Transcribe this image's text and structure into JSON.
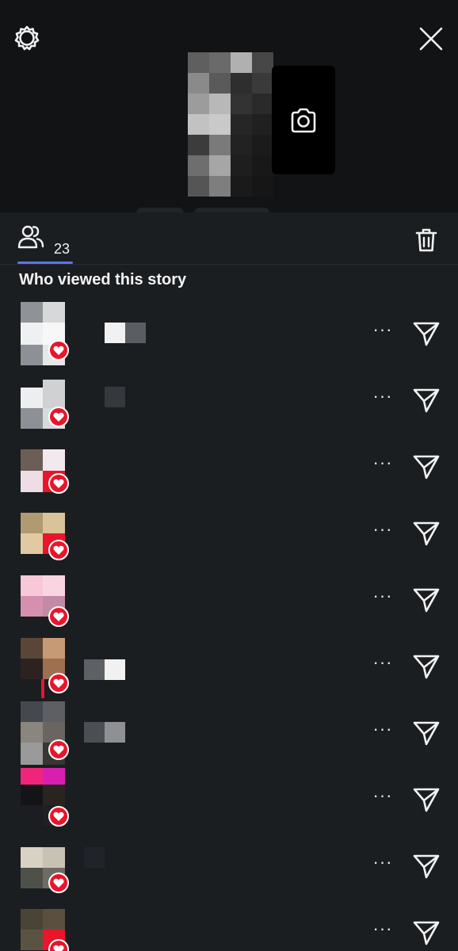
{
  "header": {
    "settings_icon": "gear-icon",
    "close_icon": "close-icon",
    "camera_icon": "camera-icon"
  },
  "tabs": {
    "viewers_icon": "people-icon",
    "viewers_count": "23",
    "delete_icon": "trash-icon"
  },
  "section": {
    "title": "Who viewed this story"
  },
  "viewer_row": {
    "more_label": "···",
    "like_icon": "heart-icon",
    "send_icon": "send-icon"
  },
  "colors": {
    "background": "#1b1e21",
    "header_background": "#111315",
    "accent": "#5b76e6",
    "like_badge": "#e8152b"
  }
}
